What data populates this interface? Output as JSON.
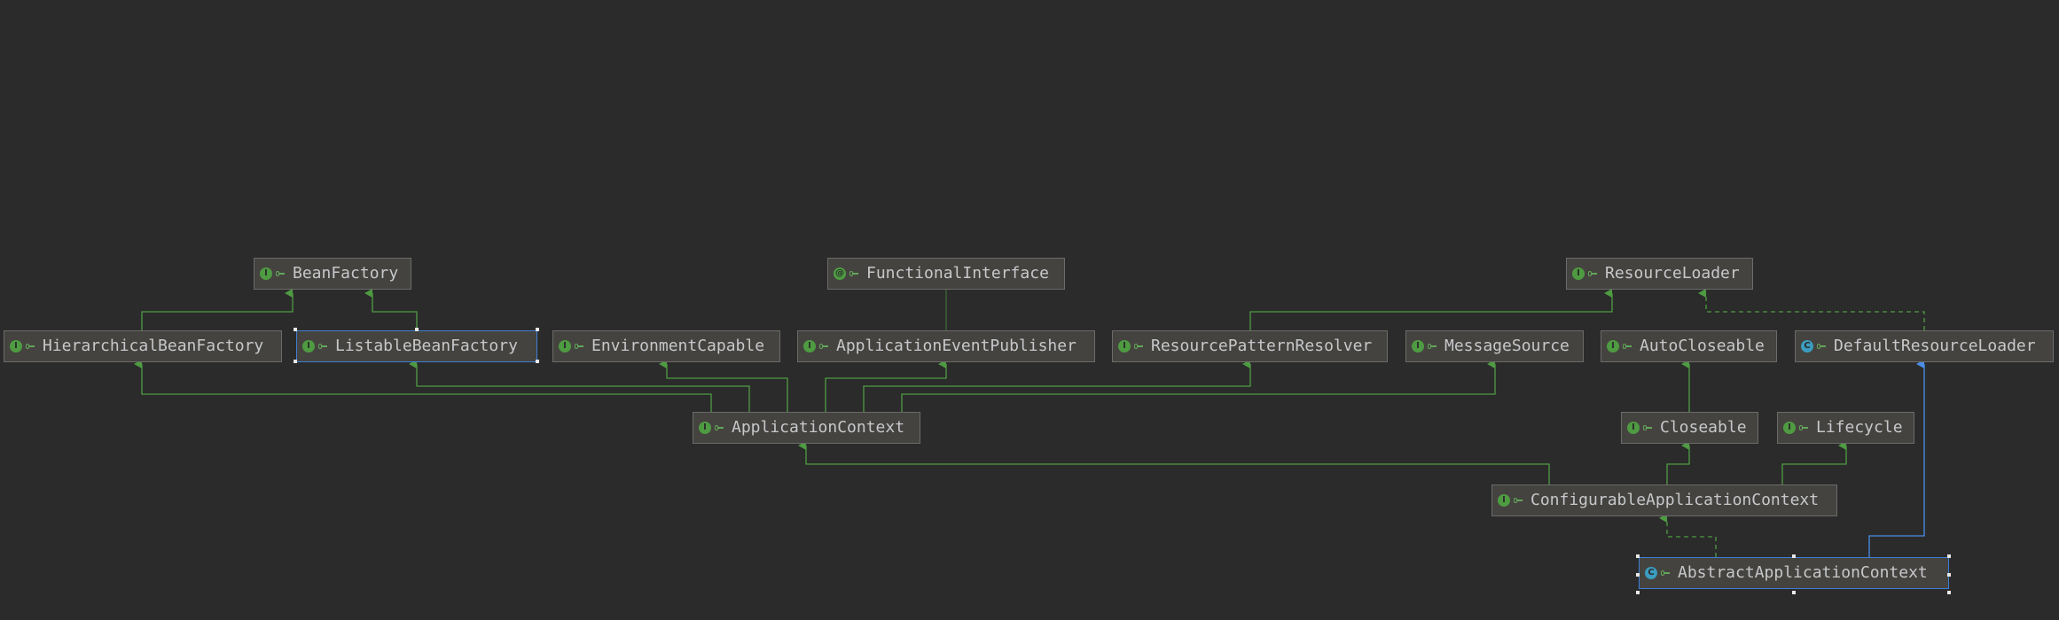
{
  "diagram": {
    "nodes": [
      {
        "id": "BeanFactory",
        "label": "BeanFactory",
        "kind": "I"
      },
      {
        "id": "FunctionalInterface",
        "label": "FunctionalInterface",
        "kind": "@"
      },
      {
        "id": "ResourceLoader",
        "label": "ResourceLoader",
        "kind": "I"
      },
      {
        "id": "HierarchicalBeanFactory",
        "label": "HierarchicalBeanFactory",
        "kind": "I"
      },
      {
        "id": "ListableBeanFactory",
        "label": "ListableBeanFactory",
        "kind": "I"
      },
      {
        "id": "EnvironmentCapable",
        "label": "EnvironmentCapable",
        "kind": "I"
      },
      {
        "id": "ApplicationEventPublisher",
        "label": "ApplicationEventPublisher",
        "kind": "I"
      },
      {
        "id": "ResourcePatternResolver",
        "label": "ResourcePatternResolver",
        "kind": "I"
      },
      {
        "id": "MessageSource",
        "label": "MessageSource",
        "kind": "I"
      },
      {
        "id": "AutoCloseable",
        "label": "AutoCloseable",
        "kind": "I"
      },
      {
        "id": "DefaultResourceLoader",
        "label": "DefaultResourceLoader",
        "kind": "C"
      },
      {
        "id": "ApplicationContext",
        "label": "ApplicationContext",
        "kind": "I"
      },
      {
        "id": "Closeable",
        "label": "Closeable",
        "kind": "I"
      },
      {
        "id": "Lifecycle",
        "label": "Lifecycle",
        "kind": "I"
      },
      {
        "id": "ConfigurableApplicationContext",
        "label": "ConfigurableApplicationContext",
        "kind": "I"
      },
      {
        "id": "AbstractApplicationContext",
        "label": "AbstractApplicationContext",
        "kind": "C"
      }
    ],
    "edges": [
      {
        "from": "HierarchicalBeanFactory",
        "to": "BeanFactory",
        "type": "extends"
      },
      {
        "from": "ListableBeanFactory",
        "to": "BeanFactory",
        "type": "extends"
      },
      {
        "from": "ApplicationEventPublisher",
        "to": "FunctionalInterface",
        "type": "annotated"
      },
      {
        "from": "ResourcePatternResolver",
        "to": "ResourceLoader",
        "type": "extends"
      },
      {
        "from": "DefaultResourceLoader",
        "to": "ResourceLoader",
        "type": "implements"
      },
      {
        "from": "ApplicationContext",
        "to": "HierarchicalBeanFactory",
        "type": "extends"
      },
      {
        "from": "ApplicationContext",
        "to": "ListableBeanFactory",
        "type": "extends"
      },
      {
        "from": "ApplicationContext",
        "to": "EnvironmentCapable",
        "type": "extends"
      },
      {
        "from": "ApplicationContext",
        "to": "ApplicationEventPublisher",
        "type": "extends"
      },
      {
        "from": "ApplicationContext",
        "to": "ResourcePatternResolver",
        "type": "extends"
      },
      {
        "from": "ApplicationContext",
        "to": "MessageSource",
        "type": "extends"
      },
      {
        "from": "Closeable",
        "to": "AutoCloseable",
        "type": "extends"
      },
      {
        "from": "ConfigurableApplicationContext",
        "to": "ApplicationContext",
        "type": "extends"
      },
      {
        "from": "ConfigurableApplicationContext",
        "to": "Closeable",
        "type": "extends"
      },
      {
        "from": "ConfigurableApplicationContext",
        "to": "Lifecycle",
        "type": "extends"
      },
      {
        "from": "AbstractApplicationContext",
        "to": "ConfigurableApplicationContext",
        "type": "implements"
      },
      {
        "from": "AbstractApplicationContext",
        "to": "DefaultResourceLoader",
        "type": "extends-class"
      }
    ],
    "selected": [
      "ListableBeanFactory",
      "AbstractApplicationContext"
    ]
  },
  "colors": {
    "background": "#2b2b2b",
    "node_fill": "#45433f",
    "node_border": "#6b6b6b",
    "text": "#c6c8cb",
    "interface_edge": "#4e9b42",
    "class_edge": "#4a8ee8",
    "selection": "#3d7ed6",
    "interface_badge": "#4e9b42",
    "class_badge": "#3b9cbf"
  }
}
